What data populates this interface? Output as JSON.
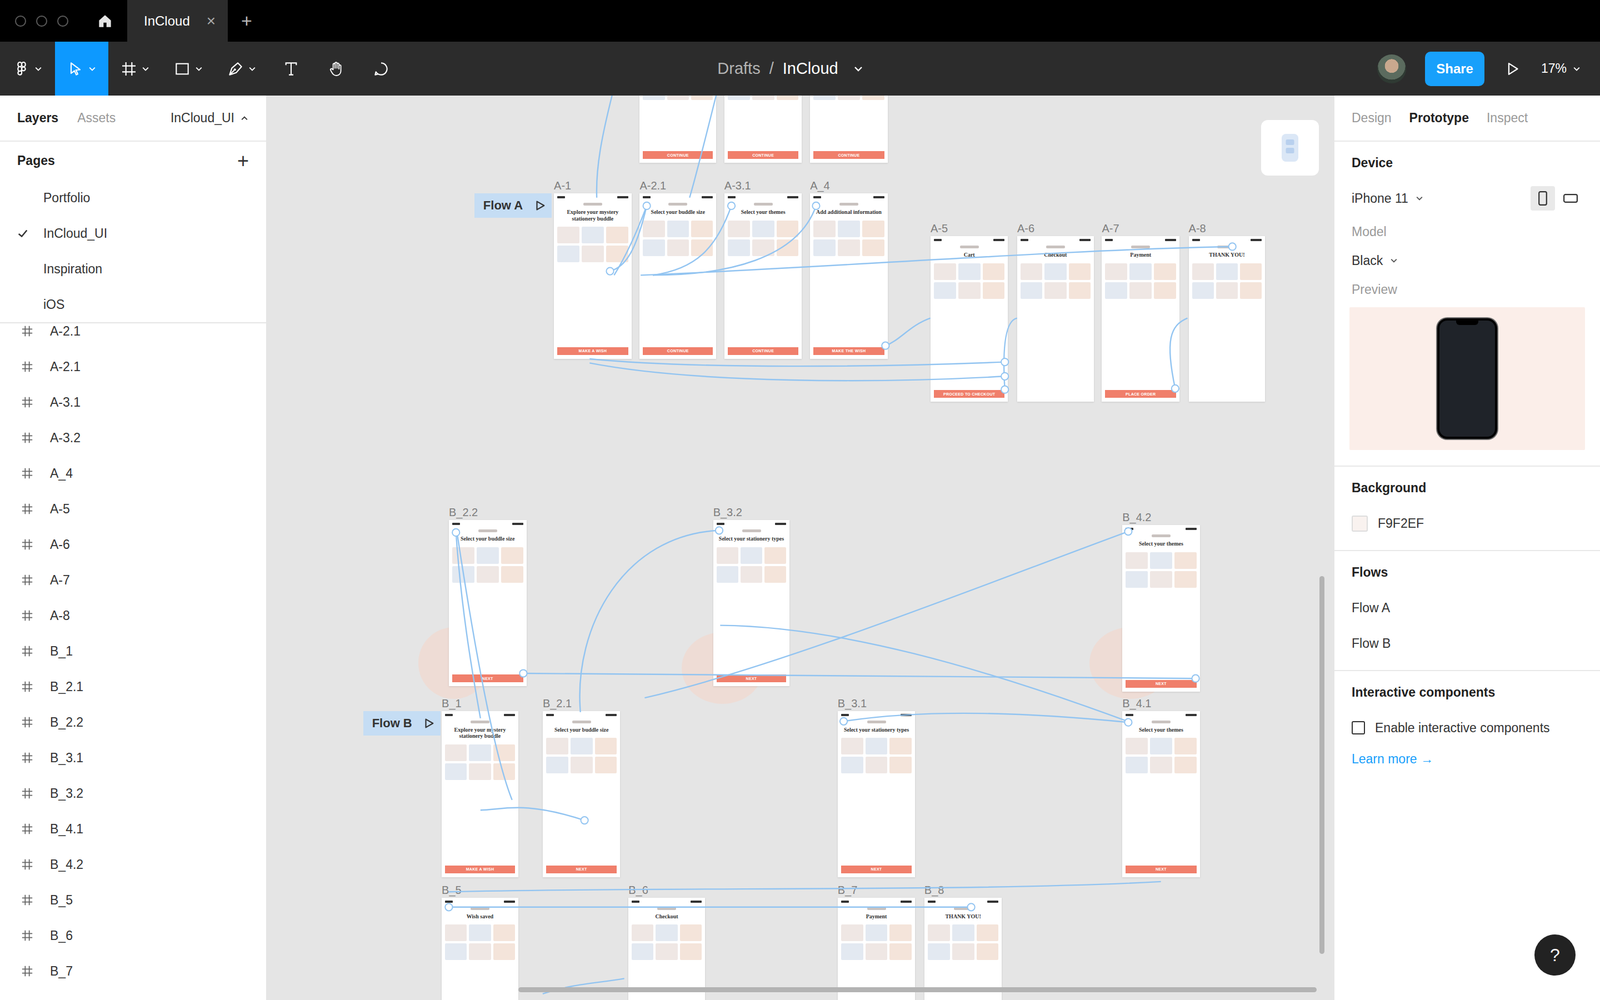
{
  "window": {
    "tab_title": "InCloud",
    "tab_close": "×",
    "new_tab": "+"
  },
  "toolbar": {
    "tools": [
      {
        "name": "main-menu",
        "menu": true,
        "selected": false
      },
      {
        "name": "move",
        "menu": true,
        "selected": true
      },
      {
        "name": "frame",
        "menu": true,
        "selected": false
      },
      {
        "name": "shape",
        "menu": true,
        "selected": false
      },
      {
        "name": "pen",
        "menu": true,
        "selected": false
      },
      {
        "name": "text",
        "menu": false,
        "selected": false
      },
      {
        "name": "hand",
        "menu": false,
        "selected": false
      },
      {
        "name": "comment",
        "menu": false,
        "selected": false
      }
    ],
    "breadcrumb_parent": "Drafts",
    "separator": "/",
    "file_name": "InCloud",
    "share": "Share",
    "zoom": "17%"
  },
  "left_panel": {
    "tabs": [
      {
        "label": "Layers",
        "selected": true
      },
      {
        "label": "Assets",
        "selected": false
      }
    ],
    "page_menu": "InCloud_UI",
    "pages_heading": "Pages",
    "add_page": "+",
    "pages": [
      {
        "label": "Portfolio",
        "selected": false
      },
      {
        "label": "InCloud_UI",
        "selected": true
      },
      {
        "label": "Inspiration",
        "selected": false
      },
      {
        "label": "iOS",
        "selected": false
      }
    ],
    "layers": [
      "A-2.1",
      "A-2.1",
      "A-3.1",
      "A-3.2",
      "A_4",
      "A-5",
      "A-6",
      "A-7",
      "A-8",
      "B_1",
      "B_2.1",
      "B_2.2",
      "B_3.1",
      "B_3.2",
      "B_4.1",
      "B_4.2",
      "B_5",
      "B_6",
      "B_7"
    ]
  },
  "canvas": {
    "flows": [
      {
        "label": "Flow A"
      },
      {
        "label": "Flow B"
      }
    ],
    "offscreen_frames": [
      {
        "button": "CONTINUE"
      },
      {
        "button": "CONTINUE"
      },
      {
        "button": "CONTINUE"
      }
    ],
    "frames": [
      {
        "label": "A-1",
        "title": "Explore your mystery stationery buddle",
        "button": "MAKE A WISH"
      },
      {
        "label": "A-2.1",
        "title": "Select your buddle size",
        "button": "CONTINUE"
      },
      {
        "label": "A-3.1",
        "title": "Select your themes",
        "button": "CONTINUE"
      },
      {
        "label": "A_4",
        "title": "Add additional information",
        "button": "MAKE THE WISH"
      },
      {
        "label": "A-5",
        "title": "Cart",
        "button": "PROCEED TO CHECKOUT"
      },
      {
        "label": "A-6",
        "title": "Checkout",
        "button": null
      },
      {
        "label": "A-7",
        "title": "Payment",
        "button": "PLACE ORDER"
      },
      {
        "label": "A-8",
        "title": "THANK YOU!",
        "button": null
      },
      {
        "label": "B_2.2",
        "title": "Select your buddle size",
        "button": "NEXT"
      },
      {
        "label": "B_3.2",
        "title": "Select your stationery types",
        "button": "NEXT"
      },
      {
        "label": "B_4.2",
        "title": "Select your themes",
        "button": "NEXT"
      },
      {
        "label": "B_1",
        "title": "Explore your mystery stationery buddle",
        "button": "MAKE A WISH"
      },
      {
        "label": "B_2.1",
        "title": "Select your buddle size",
        "button": "NEXT"
      },
      {
        "label": "B_3.1",
        "title": "Select your stationery types",
        "button": "NEXT"
      },
      {
        "label": "B_4.1",
        "title": "Select your themes",
        "button": "NEXT"
      },
      {
        "label": "B_5",
        "title": "Wish saved",
        "button": null
      },
      {
        "label": "B_6",
        "title": "Checkout",
        "button": null
      },
      {
        "label": "B_7",
        "title": "Payment",
        "button": null
      },
      {
        "label": "B_8",
        "title": "THANK YOU!",
        "button": null
      }
    ]
  },
  "right_panel": {
    "tabs": [
      {
        "label": "Design",
        "selected": false
      },
      {
        "label": "Prototype",
        "selected": true
      },
      {
        "label": "Inspect",
        "selected": false
      }
    ],
    "device": {
      "heading": "Device",
      "value": "iPhone 11",
      "orientations": [
        {
          "name": "portrait",
          "selected": true
        },
        {
          "name": "landscape",
          "selected": false
        }
      ]
    },
    "model": {
      "label": "Model",
      "value": "Black"
    },
    "preview": {
      "label": "Preview"
    },
    "background": {
      "heading": "Background",
      "value": "F9F2EF",
      "color": "#F9F2EF"
    },
    "flows": {
      "heading": "Flows",
      "items": [
        "Flow A",
        "Flow B"
      ]
    },
    "interactive": {
      "heading": "Interactive components",
      "checkbox_label": "Enable interactive components",
      "checked": false,
      "link": "Learn more →"
    }
  },
  "help": "?"
}
